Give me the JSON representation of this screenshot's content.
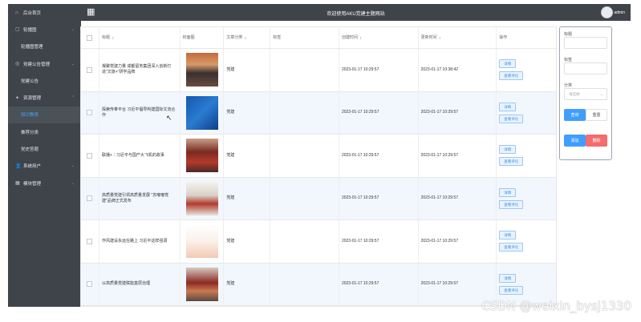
{
  "topbar": {
    "title": "欢迎使用AKU党建主题网站",
    "user": "admin"
  },
  "sidebar": {
    "items": [
      {
        "label": "后台首页",
        "icon": "home-icon"
      },
      {
        "label": "轮播图",
        "icon": "image-icon"
      },
      {
        "label": "轮播图管理",
        "icon": ""
      },
      {
        "label": "党建公告管理",
        "icon": "notice-icon"
      },
      {
        "label": "党建公告",
        "icon": ""
      },
      {
        "label": "资源管理",
        "icon": "resource-icon"
      },
      {
        "label": "知识教育",
        "icon": ""
      },
      {
        "label": "推荐分类",
        "icon": ""
      },
      {
        "label": "党史答题",
        "icon": ""
      },
      {
        "label": "系统用户",
        "icon": "user-icon"
      },
      {
        "label": "模块管理",
        "icon": "module-icon"
      }
    ]
  },
  "table": {
    "headers": [
      "标题",
      "封面图",
      "文章分类",
      "标签",
      "创建时间",
      "更新时间",
      "操作"
    ],
    "rows": [
      {
        "title": "凝聚党建力量 成都留务集团深入创新打造\"文旅+\"研学品牌",
        "category": "党建",
        "tag": "",
        "created": "2023-01-17 10:29:57",
        "updated": "2023-01-17 10:38:42"
      },
      {
        "title": "探索传奉平台 习近平倡导构建国际文流合作",
        "category": "党建",
        "tag": "",
        "created": "2023-01-17 10:29:57",
        "updated": "2023-01-17 10:29:57"
      },
      {
        "title": "联播+｜习近平与国产大飞机的故事",
        "category": "党建",
        "tag": "",
        "created": "2023-01-17 10:29:57",
        "updated": "2023-01-17 10:29:57"
      },
      {
        "title": "高质量党建引领高质量发展 \"苏嘟嘟党建\"品牌正式发布",
        "category": "党建",
        "tag": "",
        "created": "2023-01-17 10:29:57",
        "updated": "2023-01-17 10:29:57"
      },
      {
        "title": "作风建设永远在路上 习近平这样强调",
        "category": "党建",
        "tag": "",
        "created": "2023-01-17 10:29:57",
        "updated": "2023-01-17 10:29:57"
      },
      {
        "title": "以高质量党建赋能基层治理",
        "category": "党建",
        "tag": "",
        "created": "2023-01-17 10:29:57",
        "updated": "2023-01-17 10:29:57"
      }
    ],
    "btn_detail": "详情",
    "btn_comments": "查看评论"
  },
  "filter": {
    "label_title": "标题",
    "label_tag": "标签",
    "label_category": "分类",
    "category_placeholder": "请选择",
    "btn_search": "查询",
    "btn_reset": "重置",
    "btn_add": "添加",
    "btn_delete": "删除"
  },
  "watermark": "CSDN @weixin_bysj1330"
}
